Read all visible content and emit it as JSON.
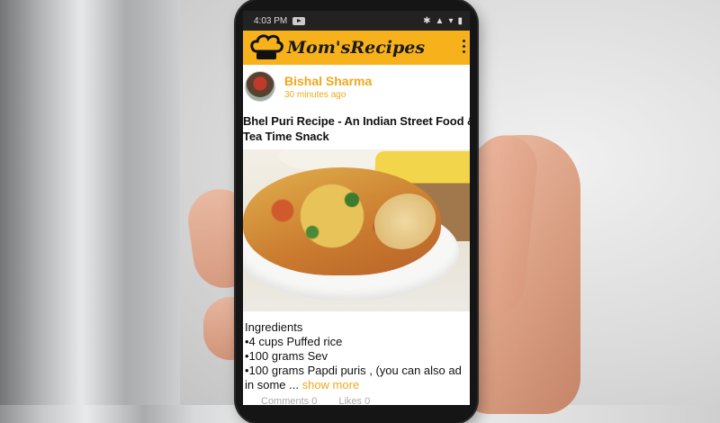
{
  "status_bar": {
    "time": "4:03 PM"
  },
  "app": {
    "title": "Mom'sRecipes"
  },
  "post": {
    "author_name": "Bishal Sharma",
    "posted_ago": "30 minutes ago",
    "title_line1": "Bhel Puri Recipe - An Indian Street Food &",
    "title_line2": "Tea Time Snack",
    "ingredients_heading": "Ingredients",
    "ingredients": [
      "•4 cups Puffed rice",
      "•100 grams Sev",
      "•100 grams Papdi puris , (you can also ad",
      "in some ..."
    ],
    "show_more_label": "show more",
    "comments_label": "Comments 0",
    "likes_label": "Likes 0"
  },
  "colors": {
    "accent": "#f7b21b",
    "name": "#f0a81a"
  },
  "icons": [
    "chef-hat-icon",
    "overflow-menu-icon",
    "youtube-icon",
    "bluetooth-icon",
    "wifi-icon",
    "signal-icon",
    "battery-icon"
  ]
}
